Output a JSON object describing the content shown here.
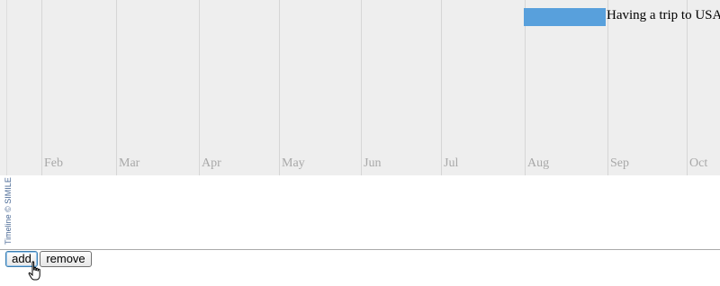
{
  "timeline": {
    "months": [
      "Feb",
      "Mar",
      "Apr",
      "May",
      "Jun",
      "Jul",
      "Aug",
      "Sep",
      "Oct"
    ],
    "event": {
      "label": "Having a trip to USA",
      "color": "#58a0dc"
    },
    "credit": "Timeline © SIMILE"
  },
  "buttons": {
    "add_label": "add",
    "remove_label": "remove"
  },
  "cursor_icon": "hand-pointer-icon"
}
